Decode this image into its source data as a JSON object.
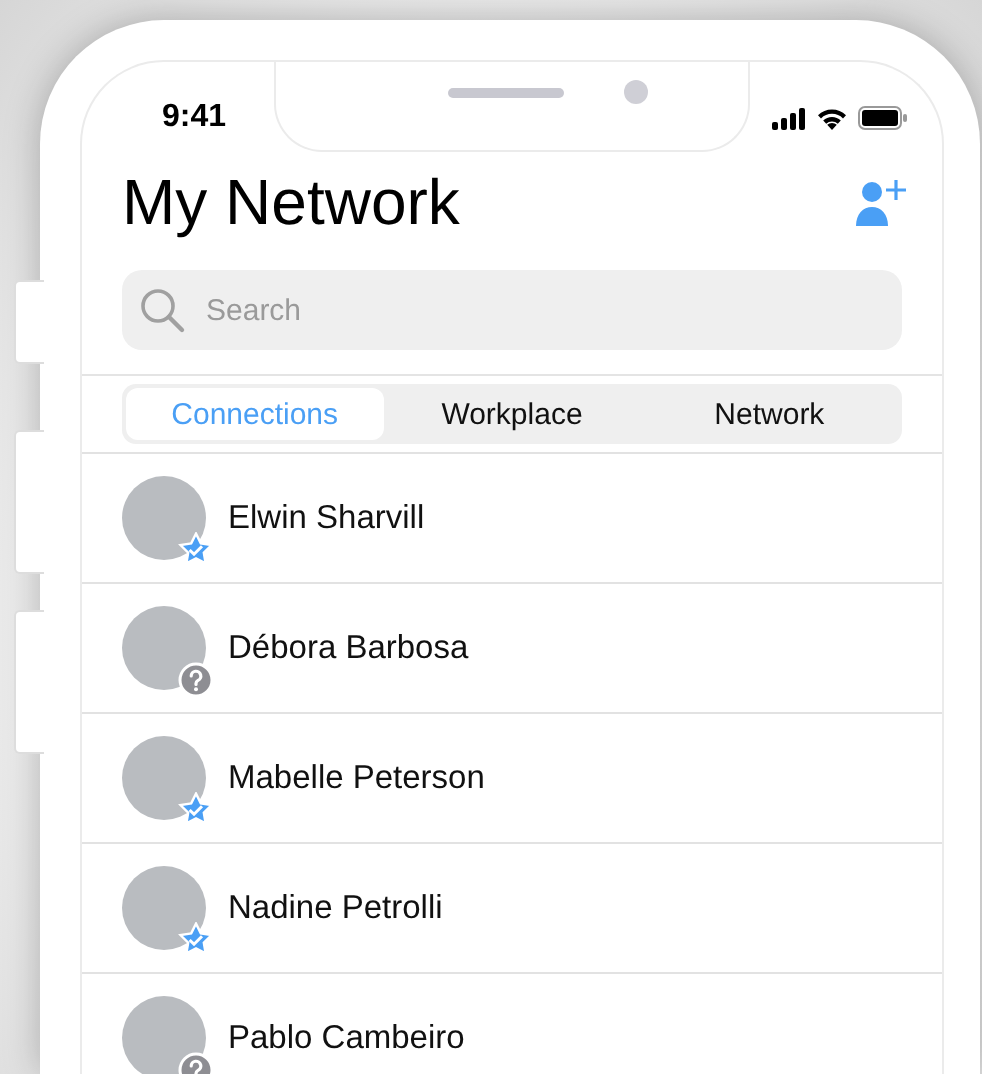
{
  "status_bar": {
    "time": "9:41"
  },
  "header": {
    "title": "My Network"
  },
  "search": {
    "placeholder": "Search"
  },
  "tabs": [
    {
      "label": "Connections",
      "selected": true
    },
    {
      "label": "Workplace",
      "selected": false
    },
    {
      "label": "Network",
      "selected": false
    }
  ],
  "contacts": [
    {
      "name": "Elwin Sharvill",
      "badge": {
        "kind": "verified"
      }
    },
    {
      "name": "Débora Barbosa",
      "badge": {
        "kind": "unknown"
      }
    },
    {
      "name": "Mabelle Peterson",
      "badge": {
        "kind": "verified"
      }
    },
    {
      "name": "Nadine Petrolli",
      "badge": {
        "kind": "verified"
      }
    },
    {
      "name": "Pablo Cambeiro",
      "badge": {
        "kind": "unknown"
      }
    }
  ]
}
